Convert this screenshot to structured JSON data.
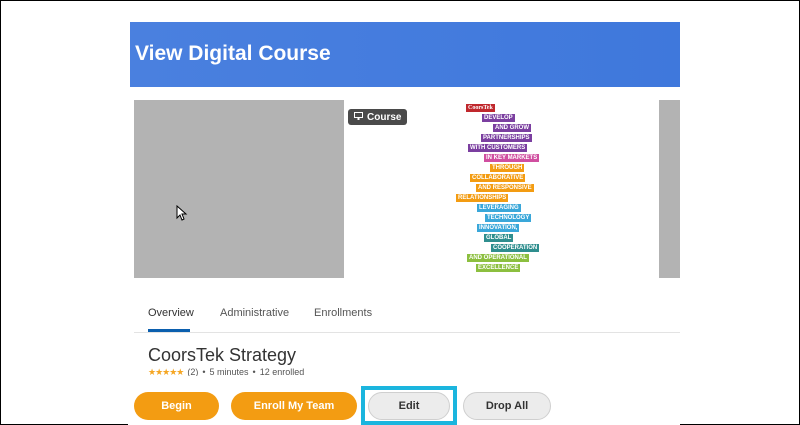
{
  "header": {
    "title": "View Digital Course"
  },
  "badge": {
    "icon": "course-icon",
    "label": "Course"
  },
  "poster": {
    "logo": "CoorsTek",
    "lines": [
      {
        "text": "DEVELOP",
        "color": "#7b3fa0"
      },
      {
        "text": "AND GROW",
        "color": "#7b3fa0"
      },
      {
        "text": "PARTNERSHIPS",
        "color": "#7b3fa0"
      },
      {
        "text": "WITH CUSTOMERS",
        "color": "#7b3fa0"
      },
      {
        "text": "IN KEY MARKETS",
        "color": "#d04fa0"
      },
      {
        "text": "THROUGH",
        "color": "#f39c12"
      },
      {
        "text": "COLLABORATIVE",
        "color": "#f39c12"
      },
      {
        "text": "AND RESPONSIVE",
        "color": "#f39c12"
      },
      {
        "text": "RELATIONSHIPS",
        "color": "#f39c12"
      },
      {
        "text": "LEVERAGING",
        "color": "#3aa7d9"
      },
      {
        "text": "TECHNOLOGY",
        "color": "#3aa7d9"
      },
      {
        "text": "INNOVATION,",
        "color": "#3aa7d9"
      },
      {
        "text": "GLOBAL",
        "color": "#2f8e8e"
      },
      {
        "text": "COOPERATION",
        "color": "#2f8e8e"
      },
      {
        "text": "AND OPERATIONAL",
        "color": "#8cbf3f"
      },
      {
        "text": "EXCELLENCE",
        "color": "#8cbf3f"
      }
    ]
  },
  "tabs": [
    {
      "label": "Overview",
      "active": true
    },
    {
      "label": "Administrative",
      "active": false
    },
    {
      "label": "Enrollments",
      "active": false
    }
  ],
  "course": {
    "title": "CoorsTek Strategy",
    "rating_count": "(2)",
    "duration": "5 minutes",
    "enrolled": "12 enrolled"
  },
  "actions": {
    "begin": "Begin",
    "enroll_team": "Enroll My Team",
    "edit": "Edit",
    "drop_all": "Drop All"
  },
  "colors": {
    "header": "#4a80df",
    "primary_button": "#f39c12",
    "highlight": "#1bb5de"
  }
}
